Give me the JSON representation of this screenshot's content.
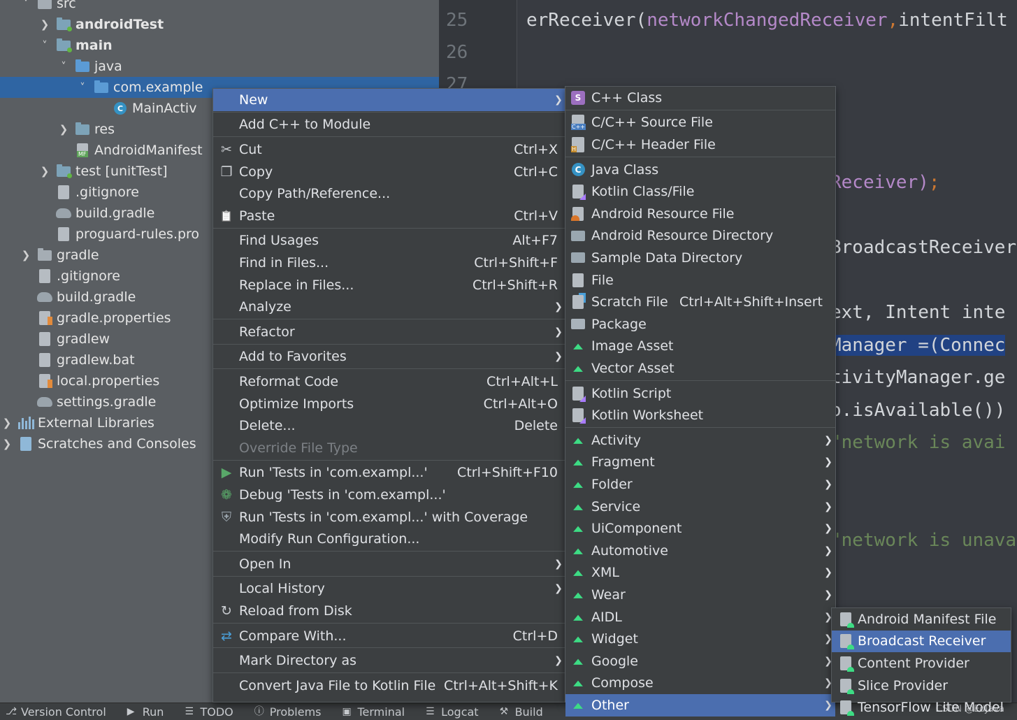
{
  "project_tree": [
    {
      "label": "src",
      "indent": 1,
      "chev": "down",
      "icon": "folder",
      "bold": false
    },
    {
      "label": "androidTest",
      "indent": 2,
      "chev": "right",
      "icon": "folder-test",
      "bold": true
    },
    {
      "label": "main",
      "indent": 2,
      "chev": "down",
      "icon": "folder-test",
      "bold": true
    },
    {
      "label": "java",
      "indent": 3,
      "chev": "down",
      "icon": "folder-blue",
      "bold": false
    },
    {
      "label": "com.example",
      "indent": 4,
      "chev": "down",
      "icon": "package",
      "bold": false,
      "selected": true
    },
    {
      "label": "MainActiv",
      "indent": 5,
      "chev": "",
      "icon": "java-class",
      "bold": false
    },
    {
      "label": "res",
      "indent": 3,
      "chev": "right",
      "icon": "folder-res",
      "bold": false
    },
    {
      "label": "AndroidManifest",
      "indent": 3,
      "chev": "",
      "icon": "manifest",
      "bold": false
    },
    {
      "label": "test [unitTest]",
      "indent": 2,
      "chev": "right",
      "icon": "folder-test",
      "bold": false,
      "bold_part": "[unitTest]"
    },
    {
      "label": ".gitignore",
      "indent": 2,
      "chev": "",
      "icon": "file",
      "bold": false
    },
    {
      "label": "build.gradle",
      "indent": 2,
      "chev": "",
      "icon": "gradle",
      "bold": false
    },
    {
      "label": "proguard-rules.pro",
      "indent": 2,
      "chev": "",
      "icon": "file",
      "bold": false
    },
    {
      "label": "gradle",
      "indent": 1,
      "chev": "right",
      "icon": "folder",
      "bold": false
    },
    {
      "label": ".gitignore",
      "indent": 1,
      "chev": "",
      "icon": "file",
      "bold": false
    },
    {
      "label": "build.gradle",
      "indent": 1,
      "chev": "",
      "icon": "gradle",
      "bold": false
    },
    {
      "label": "gradle.properties",
      "indent": 1,
      "chev": "",
      "icon": "properties",
      "bold": false
    },
    {
      "label": "gradlew",
      "indent": 1,
      "chev": "",
      "icon": "file",
      "bold": false
    },
    {
      "label": "gradlew.bat",
      "indent": 1,
      "chev": "",
      "icon": "file",
      "bold": false
    },
    {
      "label": "local.properties",
      "indent": 1,
      "chev": "",
      "icon": "properties",
      "bold": false
    },
    {
      "label": "settings.gradle",
      "indent": 1,
      "chev": "",
      "icon": "gradle",
      "bold": false
    },
    {
      "label": "External Libraries",
      "indent": 0,
      "chev": "right",
      "icon": "library",
      "bold": false
    },
    {
      "label": "Scratches and Consoles",
      "indent": 0,
      "chev": "right",
      "icon": "scratch",
      "bold": false
    }
  ],
  "editor": {
    "line_numbers": [
      "25",
      "26",
      "27"
    ],
    "code_lines": [
      {
        "parts": [
          {
            "t": "erReceiver(",
            "c": ""
          },
          {
            "t": "networkChangedReceiver",
            "c": "purple"
          },
          {
            "t": ",",
            "c": "orange"
          },
          {
            "t": "intentFilt",
            "c": ""
          }
        ]
      },
      {
        "parts": [
          {
            "t": "Receiver)",
            "c": "purple"
          },
          {
            "t": ";",
            "c": "orange"
          }
        ]
      },
      {
        "parts": [
          {
            "t": "BroadcastReceiver",
            "c": ""
          }
        ]
      },
      {
        "parts": [
          {
            "t": "ext, Intent inte",
            "c": ""
          }
        ]
      },
      {
        "parts": [
          {
            "t": "Manager =(Connec",
            "c": "hl"
          }
        ]
      },
      {
        "parts": [
          {
            "t": "tivityManager.ge",
            "c": ""
          }
        ]
      },
      {
        "parts": [
          {
            "t": "o.isAvailable())",
            "c": ""
          }
        ]
      },
      {
        "parts": [
          {
            "t": "\"network is avai",
            "c": "green"
          }
        ]
      },
      {
        "parts": [
          {
            "t": "\"network is unava",
            "c": "green"
          }
        ]
      }
    ]
  },
  "context_menu": {
    "groups": [
      [
        {
          "label": "New",
          "icon": "",
          "shortcut": "",
          "arrow": true,
          "active": true
        }
      ],
      [
        {
          "label": "Add C++ to Module",
          "icon": "",
          "shortcut": "",
          "arrow": false
        }
      ],
      [
        {
          "label": "Cut",
          "icon": "scissors",
          "shortcut": "Ctrl+X",
          "arrow": false
        },
        {
          "label": "Copy",
          "icon": "copy",
          "shortcut": "Ctrl+C",
          "arrow": false
        },
        {
          "label": "Copy Path/Reference...",
          "icon": "",
          "shortcut": "",
          "arrow": false
        },
        {
          "label": "Paste",
          "icon": "paste",
          "shortcut": "Ctrl+V",
          "arrow": false
        }
      ],
      [
        {
          "label": "Find Usages",
          "icon": "",
          "shortcut": "Alt+F7",
          "arrow": false
        },
        {
          "label": "Find in Files...",
          "icon": "",
          "shortcut": "Ctrl+Shift+F",
          "arrow": false
        },
        {
          "label": "Replace in Files...",
          "icon": "",
          "shortcut": "Ctrl+Shift+R",
          "arrow": false
        },
        {
          "label": "Analyze",
          "icon": "",
          "shortcut": "",
          "arrow": true
        }
      ],
      [
        {
          "label": "Refactor",
          "icon": "",
          "shortcut": "",
          "arrow": true
        }
      ],
      [
        {
          "label": "Add to Favorites",
          "icon": "",
          "shortcut": "",
          "arrow": true
        }
      ],
      [
        {
          "label": "Reformat Code",
          "icon": "",
          "shortcut": "Ctrl+Alt+L",
          "arrow": false
        },
        {
          "label": "Optimize Imports",
          "icon": "",
          "shortcut": "Ctrl+Alt+O",
          "arrow": false
        },
        {
          "label": "Delete...",
          "icon": "",
          "shortcut": "Delete",
          "arrow": false
        },
        {
          "label": "Override File Type",
          "icon": "",
          "shortcut": "",
          "arrow": false,
          "disabled": true
        }
      ],
      [
        {
          "label": "Run 'Tests in 'com.exampl...'",
          "icon": "run",
          "shortcut": "Ctrl+Shift+F10",
          "arrow": false
        },
        {
          "label": "Debug 'Tests in 'com.exampl...'",
          "icon": "debug",
          "shortcut": "",
          "arrow": false
        },
        {
          "label": "Run 'Tests in 'com.exampl...' with Coverage",
          "icon": "coverage",
          "shortcut": "",
          "arrow": false
        },
        {
          "label": "Modify Run Configuration...",
          "icon": "",
          "shortcut": "",
          "arrow": false
        }
      ],
      [
        {
          "label": "Open In",
          "icon": "",
          "shortcut": "",
          "arrow": true
        }
      ],
      [
        {
          "label": "Local History",
          "icon": "",
          "shortcut": "",
          "arrow": true
        },
        {
          "label": "Reload from Disk",
          "icon": "reload",
          "shortcut": "",
          "arrow": false
        }
      ],
      [
        {
          "label": "Compare With...",
          "icon": "compare",
          "shortcut": "Ctrl+D",
          "arrow": false
        }
      ],
      [
        {
          "label": "Mark Directory as",
          "icon": "",
          "shortcut": "",
          "arrow": true
        }
      ],
      [
        {
          "label": "Convert Java File to Kotlin File",
          "icon": "",
          "shortcut": "Ctrl+Alt+Shift+K",
          "arrow": false
        }
      ]
    ]
  },
  "new_menu": {
    "groups": [
      [
        {
          "label": "C++ Class",
          "icon": "cpp-class"
        }
      ],
      [
        {
          "label": "C/C++ Source File",
          "icon": "cpp-source"
        },
        {
          "label": "C/C++ Header File",
          "icon": "cpp-header"
        }
      ],
      [
        {
          "label": "Java Class",
          "icon": "java-class"
        },
        {
          "label": "Kotlin Class/File",
          "icon": "kotlin-file"
        },
        {
          "label": "Android Resource File",
          "icon": "android-resource-file"
        },
        {
          "label": "Android Resource Directory",
          "icon": "folder"
        },
        {
          "label": "Sample Data Directory",
          "icon": "folder"
        },
        {
          "label": "File",
          "icon": "file"
        },
        {
          "label": "Scratch File",
          "icon": "scratch",
          "shortcut": "Ctrl+Alt+Shift+Insert"
        },
        {
          "label": "Package",
          "icon": "package"
        },
        {
          "label": "Image Asset",
          "icon": "android"
        },
        {
          "label": "Vector Asset",
          "icon": "android"
        }
      ],
      [
        {
          "label": "Kotlin Script",
          "icon": "kotlin-file"
        },
        {
          "label": "Kotlin Worksheet",
          "icon": "kotlin-file"
        }
      ],
      [
        {
          "label": "Activity",
          "icon": "android",
          "arrow": true
        },
        {
          "label": "Fragment",
          "icon": "android",
          "arrow": true
        },
        {
          "label": "Folder",
          "icon": "android",
          "arrow": true
        },
        {
          "label": "Service",
          "icon": "android",
          "arrow": true
        },
        {
          "label": "UiComponent",
          "icon": "android",
          "arrow": true
        },
        {
          "label": "Automotive",
          "icon": "android",
          "arrow": true
        },
        {
          "label": "XML",
          "icon": "android",
          "arrow": true
        },
        {
          "label": "Wear",
          "icon": "android",
          "arrow": true
        },
        {
          "label": "AIDL",
          "icon": "android",
          "arrow": true
        },
        {
          "label": "Widget",
          "icon": "android",
          "arrow": true
        },
        {
          "label": "Google",
          "icon": "android",
          "arrow": true
        },
        {
          "label": "Compose",
          "icon": "android",
          "arrow": true
        },
        {
          "label": "Other",
          "icon": "android",
          "arrow": true,
          "active": true
        }
      ]
    ]
  },
  "other_menu": {
    "items": [
      {
        "label": "Android Manifest File",
        "icon": "android-file"
      },
      {
        "label": "Broadcast Receiver",
        "icon": "android-file",
        "active": true
      },
      {
        "label": "Content Provider",
        "icon": "android-file"
      },
      {
        "label": "Slice Provider",
        "icon": "android-file"
      },
      {
        "label": "TensorFlow Lite Model",
        "icon": "android-file"
      }
    ]
  },
  "bottom_bar": [
    {
      "label": "Version Control",
      "icon": "branch"
    },
    {
      "label": "Run",
      "icon": "run"
    },
    {
      "label": "TODO",
      "icon": "list"
    },
    {
      "label": "Problems",
      "icon": "problems"
    },
    {
      "label": "Terminal",
      "icon": "terminal"
    },
    {
      "label": "Logcat",
      "icon": "list"
    },
    {
      "label": "Build",
      "icon": "hammer"
    }
  ],
  "watermark": "CSDN @EdJava",
  "colors": {
    "menu_bg": "#3c3f41",
    "active": "#4b6eaf",
    "selected_tree": "#2f65a3",
    "android_green": "#3ddc84"
  }
}
